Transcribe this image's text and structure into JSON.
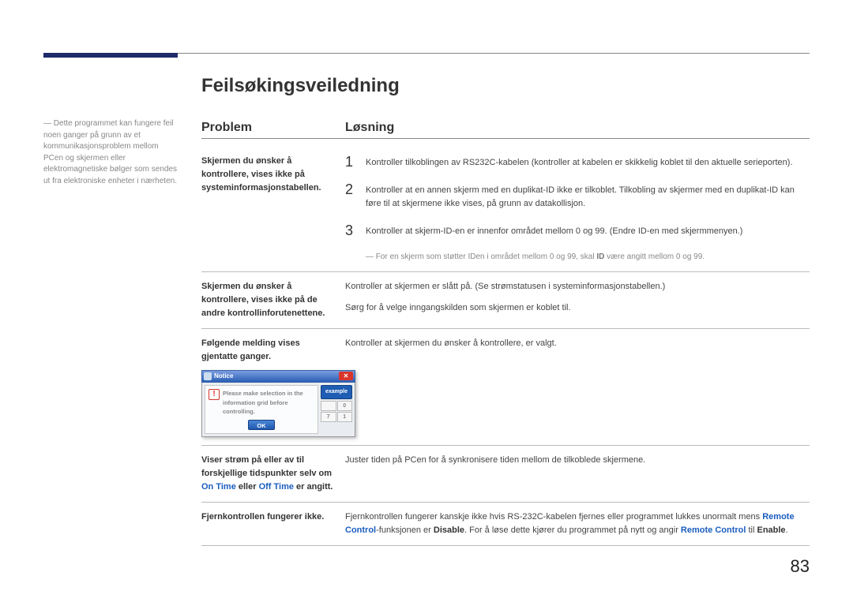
{
  "page_number": "83",
  "side_note": "Dette programmet kan fungere feil noen ganger på grunn av et kommunikasjonsproblem mellom PCen og skjermen eller elektromagnetiske bølger som sendes ut fra elektroniske enheter i nærheten.",
  "title": "Feilsøkingsveiledning",
  "headers": {
    "problem": "Problem",
    "solution": "Løsning"
  },
  "rows": {
    "r1": {
      "problem": "Skjermen du ønsker å kontrollere, vises ikke på systeminformasjonstabellen.",
      "s1": "Kontroller tilkoblingen av RS232C-kabelen (kontroller at kabelen er skikkelig koblet til den aktuelle serieporten).",
      "s2": "Kontroller at en annen skjerm med en duplikat-ID ikke er tilkoblet. Tilkobling av skjermer med en duplikat-ID kan føre til at skjermene ikke vises, på grunn av datakollisjon.",
      "s3": "Kontroller at skjerm-ID-en er innenfor området mellom 0 og 99. (Endre ID-en med skjermmenyen.)",
      "note_a": "For en skjerm som støtter IDen i området mellom 0 og 99, skal ",
      "note_b": "ID",
      "note_c": " være angitt mellom 0 og 99."
    },
    "r2": {
      "problem": "Skjermen du ønsker å kontrollere, vises ikke på de andre kontrollinforutenettene.",
      "s1": "Kontroller at skjermen er slått på. (Se strømstatusen i systeminformasjonstabellen.)",
      "s2": "Sørg for å velge inngangskilden som skjermen er koblet til."
    },
    "r3": {
      "problem": "Følgende melding vises gjentatte ganger.",
      "s1": "Kontroller at skjermen du ønsker å kontrollere, er valgt.",
      "dialog": {
        "title": "Notice",
        "msg": "Please make selection in the information grid before controlling.",
        "ok": "OK",
        "example": "example",
        "cells": [
          "",
          "0",
          "7",
          "1"
        ]
      }
    },
    "r4": {
      "problem_a": "Viser strøm på eller av til forskjellige tidspunkter selv om ",
      "problem_link1": "On Time",
      "problem_mid": " eller ",
      "problem_link2": "Off Time",
      "problem_b": " er angitt.",
      "s1": "Juster tiden på PCen for å synkronisere tiden mellom de tilkoblede skjermene."
    },
    "r5": {
      "problem": "Fjernkontrollen fungerer ikke.",
      "s_a": "Fjernkontrollen fungerer kanskje ikke hvis RS-232C-kabelen fjernes eller programmet lukkes unormalt mens ",
      "s_rc1": "Remote Control",
      "s_b": "-funksjonen er ",
      "s_dis": "Disable",
      "s_c": ". For å løse dette kjører du programmet på nytt og angir ",
      "s_rc2": "Remote Control",
      "s_d": " til ",
      "s_en": "Enable",
      "s_e": "."
    }
  }
}
